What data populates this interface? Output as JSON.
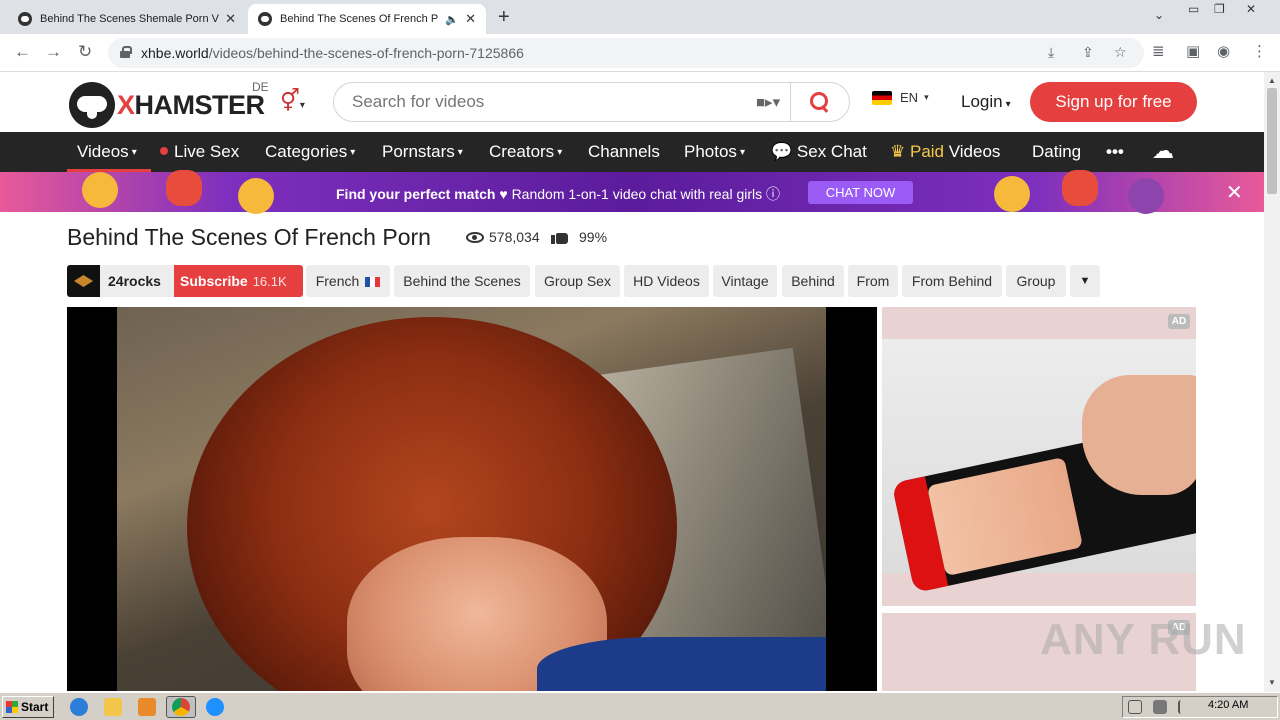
{
  "browser": {
    "tabs": [
      {
        "title": "Behind The Scenes Shemale Porn Vid",
        "active": false
      },
      {
        "title": "Behind The Scenes Of French P",
        "active": true
      }
    ],
    "new_tab_icon": "plus-icon",
    "url_host": "xhbe.world",
    "url_path": "/videos/behind-the-scenes-of-french-porn-7125866",
    "icons": [
      "back-icon",
      "forward-icon",
      "reload-icon",
      "lock-icon",
      "install-icon",
      "share-icon",
      "star-icon",
      "tab-search-icon",
      "side-panel-icon",
      "profile-icon",
      "menu-icon"
    ]
  },
  "header": {
    "logo_x": "X",
    "logo_rest": "HAMSTER",
    "region": "DE",
    "gender_symbol": "⚥",
    "search_placeholder": "Search for videos",
    "lang": "EN",
    "login": "Login",
    "signup": "Sign up for free"
  },
  "nav": {
    "items": {
      "videos": "Videos",
      "live_sex": "Live Sex",
      "categories": "Categories",
      "pornstars": "Pornstars",
      "creators": "Creators",
      "channels": "Channels",
      "photos": "Photos",
      "sex_chat": "Sex Chat",
      "paid": "Paid",
      "paid_videos": "Videos",
      "dating": "Dating",
      "more": "•••"
    },
    "colors": {
      "active": "#e53f3f",
      "paid": "#f7c948"
    }
  },
  "promo": {
    "headline": "Find your perfect match",
    "text": "Random 1-on-1 video chat with real girls",
    "cta": "CHAT NOW"
  },
  "video": {
    "title": "Behind The Scenes Of French Porn",
    "views": "578,034",
    "rating": "99%",
    "channel": "24rocks",
    "subscribe": "Subscribe",
    "subscribers": "16.1K",
    "tags": [
      "French",
      "Behind the Scenes",
      "Group Sex",
      "HD Videos",
      "Vintage",
      "Behind",
      "From",
      "From Behind",
      "Group"
    ]
  },
  "ads": {
    "badge": "AD"
  },
  "watermark": "ANY RUN",
  "taskbar": {
    "start": "Start",
    "clock": "4:20 AM"
  },
  "accent": "#e53f3f"
}
